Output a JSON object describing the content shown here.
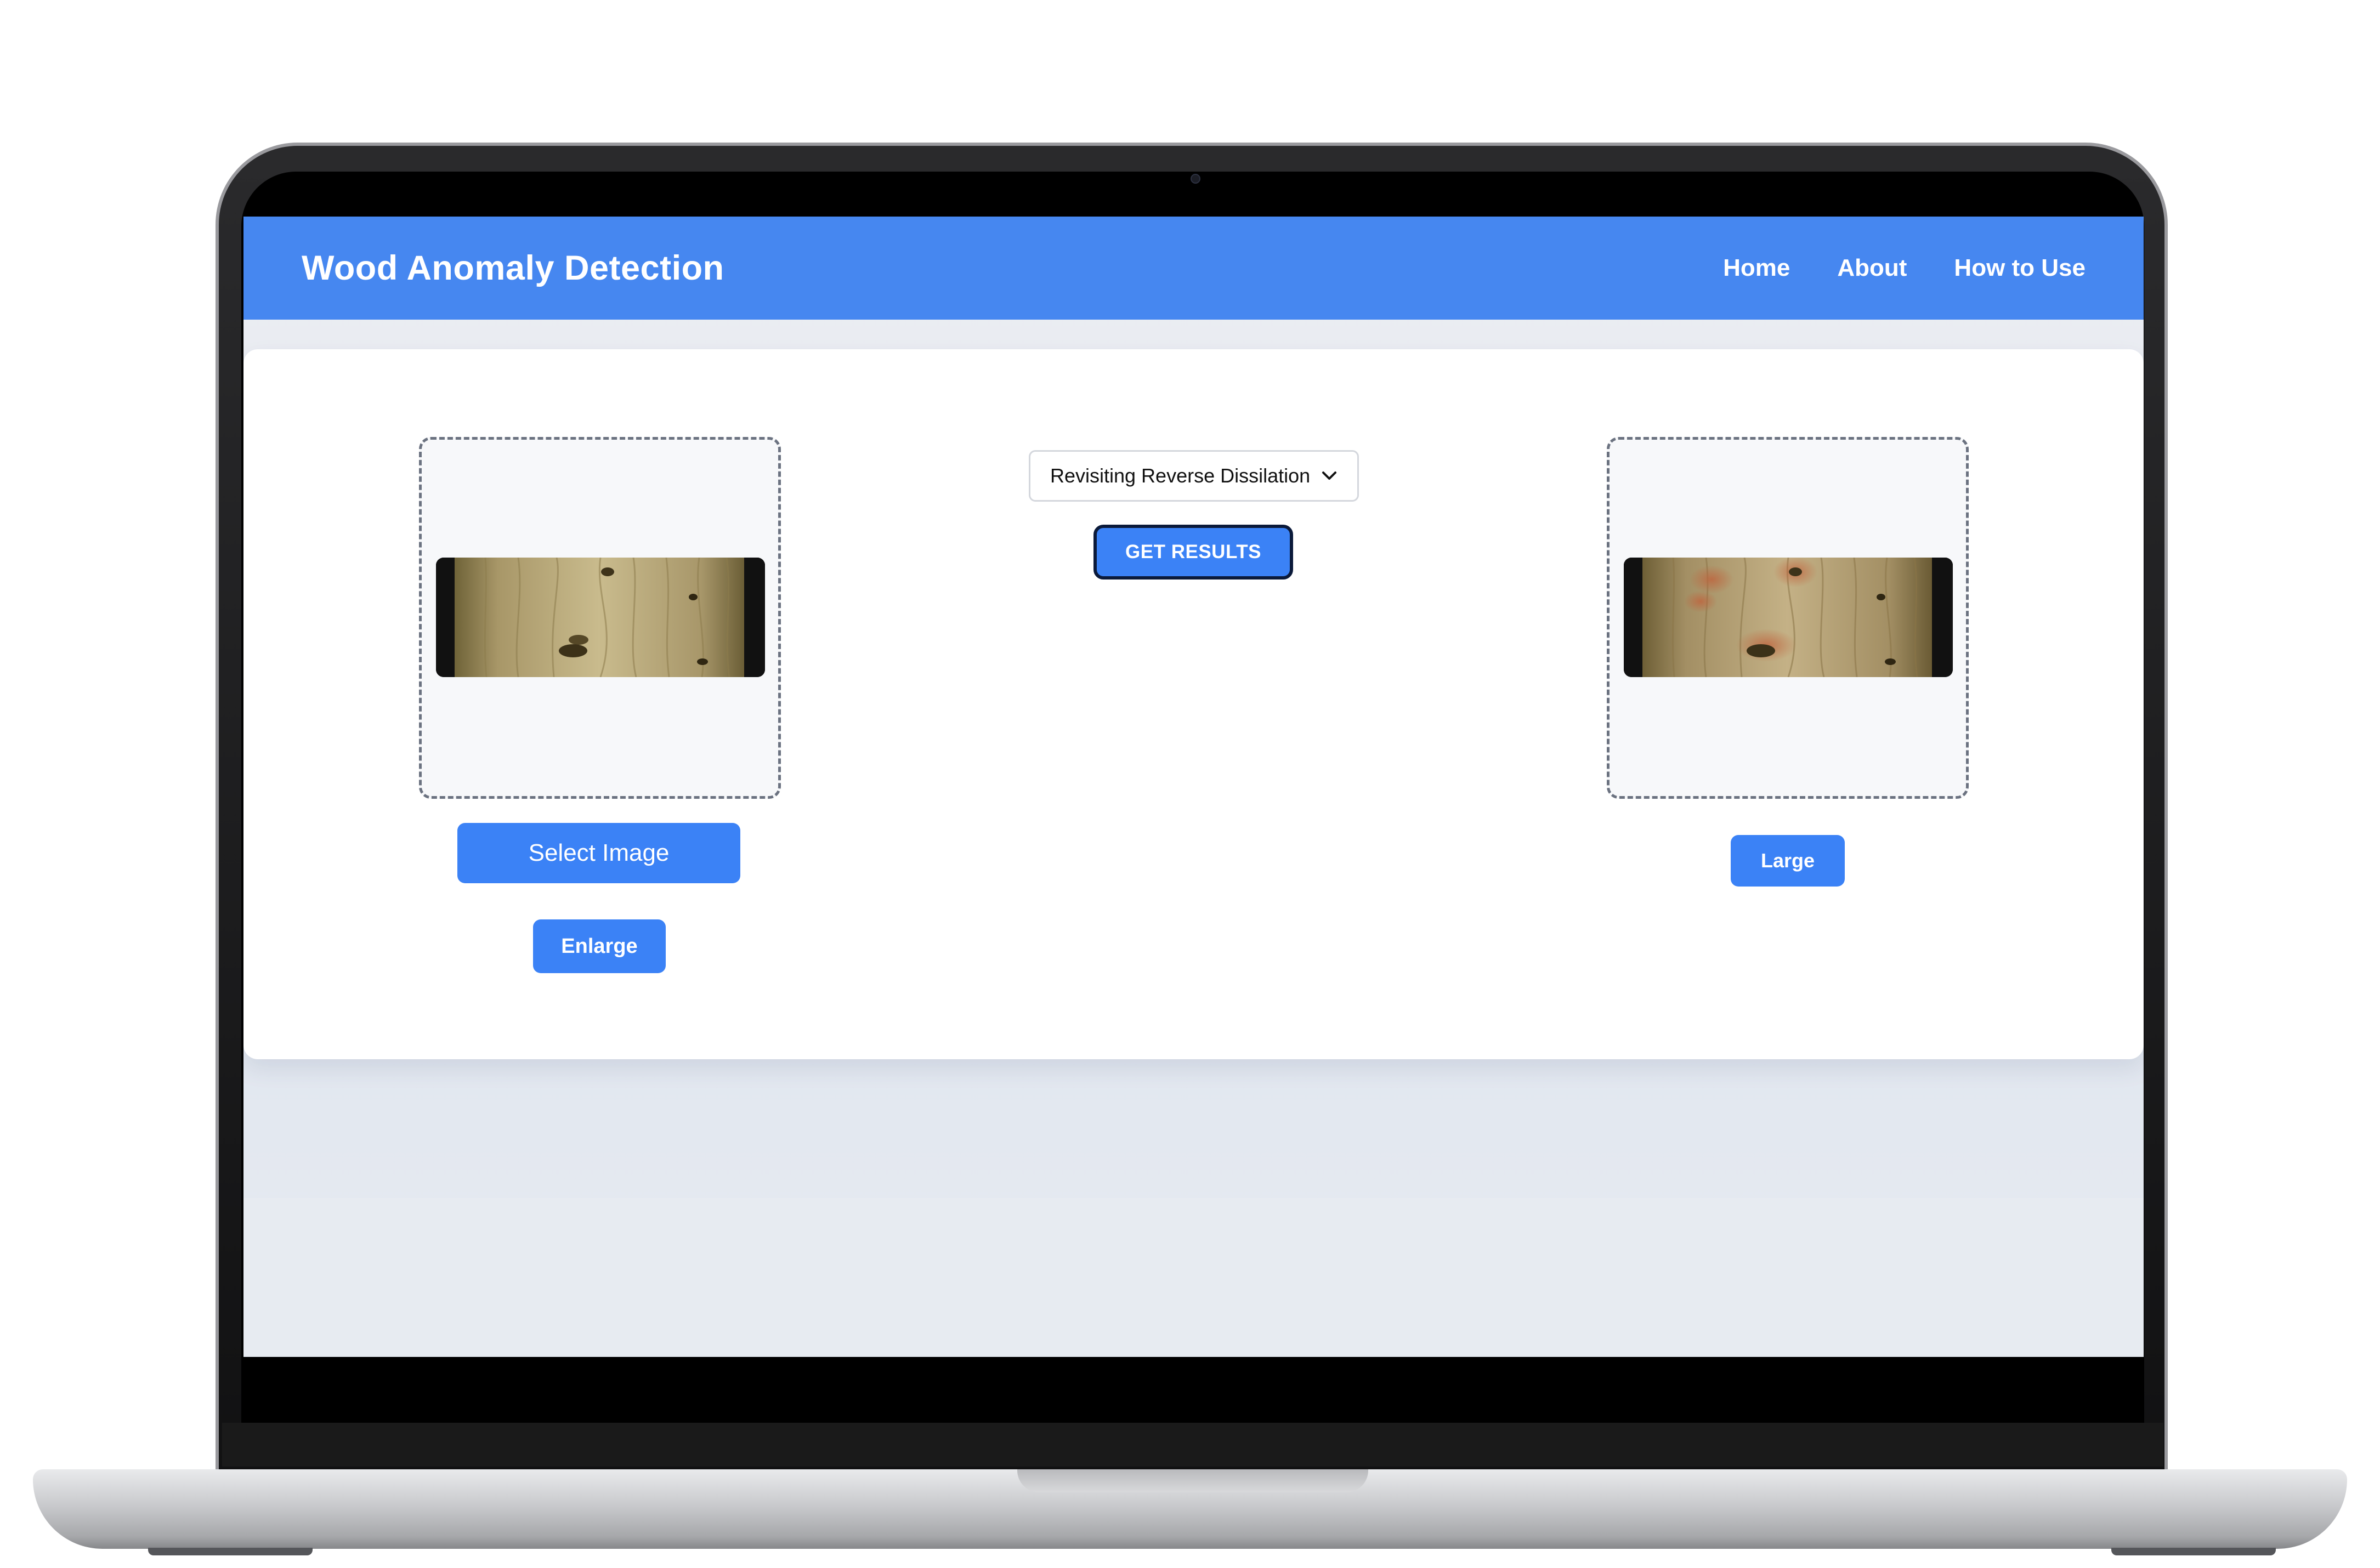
{
  "app": {
    "title": "Wood Anomaly Detection"
  },
  "nav": {
    "items": [
      {
        "label": "Home"
      },
      {
        "label": "About"
      },
      {
        "label": "How to Use"
      }
    ]
  },
  "main": {
    "input_panel": {
      "select_button_label": "Select Image",
      "enlarge_button_label": "Enlarge"
    },
    "controls": {
      "model_select_value": "Revisiting Reverse Dissilation",
      "get_results_label": "GET RESULTS"
    },
    "output_panel": {
      "large_button_label": "Large"
    }
  },
  "colors": {
    "navbar": "#4687f0",
    "button": "#3b82f6",
    "card": "#ffffff",
    "dropzone_border": "#6b7280"
  }
}
